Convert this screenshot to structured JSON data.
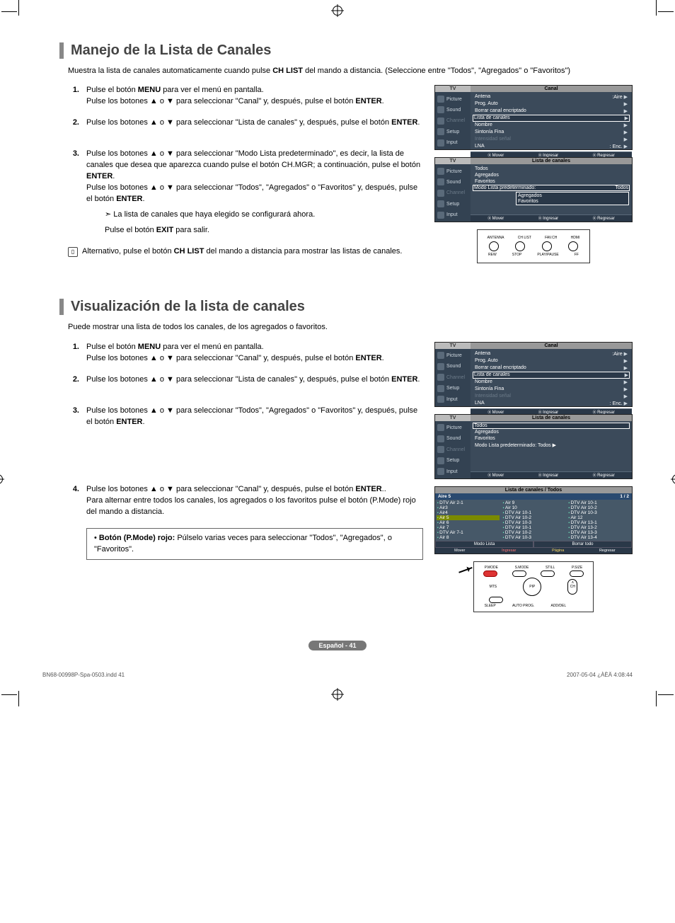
{
  "section1": {
    "title": "Manejo de la Lista de Canales",
    "intro_a": "Muestra la lista de canales automaticamente cuando pulse ",
    "intro_b_bold": "CH LIST",
    "intro_c": " del mando a distancia. (Seleccione entre \"Todos\", \"Agregados\" o \"Favoritos\")",
    "steps": {
      "s1n": "1.",
      "s1a": "Pulse el botón ",
      "s1b": "MENU",
      "s1c": " para ver el menú en pantalla.",
      "s1d": "Pulse los botones ▲ o ▼ para seleccionar \"Canal\" y, después, pulse el botón ",
      "s1e": "ENTER",
      "s1f": ".",
      "s2n": "2.",
      "s2a": "Pulse los botones ▲ o ▼ para seleccionar \"Lista de canales\" y, después, pulse el botón ",
      "s2b": "ENTER",
      "s2c": ".",
      "s3n": "3.",
      "s3a": "Pulse los botones ▲ o ▼ para seleccionar \"Modo Lista predeterminado\", es decir, la lista de canales que desea que aparezca cuando pulse el botón CH.MGR; a continuación, pulse el botón ",
      "s3b": "ENTER",
      "s3c": ".",
      "s3d": "Pulse los botones ▲ o ▼ para seleccionar \"Todos\", \"Agregados\" o \"Favoritos\" y, después, pulse el botón ",
      "s3e": "ENTER",
      "s3f": ".",
      "s3note": "La lista de canales que haya elegido se configurará ahora.",
      "s3exit_a": "Pulse el botón ",
      "s3exit_b": "EXIT",
      "s3exit_c": " para salir.",
      "alt_a": "Alternativo, pulse el botón ",
      "alt_b": "CH LIST",
      "alt_c": " del mando a distancia para mostrar las listas de canales."
    }
  },
  "section2": {
    "title": "Visualización de la lista de canales",
    "intro": "Puede mostrar una lista de todos los canales, de los agregados o favoritos.",
    "steps": {
      "s1n": "1.",
      "s1a": "Pulse el botón ",
      "s1b": "MENU",
      "s1c": " para ver el menú en pantalla.",
      "s1d": "Pulse los botones ▲ o ▼ para seleccionar \"Canal\" y, después, pulse el botón ",
      "s1e": "ENTER",
      "s1f": ".",
      "s2n": "2.",
      "s2a": "Pulse los botones ▲ o ▼ para seleccionar \"Lista de canales\" y, después, pulse el botón ",
      "s2b": "ENTER",
      "s2c": ".",
      "s3n": "3.",
      "s3a": "Pulse los botones ▲ o ▼ para seleccionar \"Todos\", \"Agregados\" o \"Favoritos\" y, después, pulse el botón ",
      "s3b": "ENTER",
      "s3c": ".",
      "s4n": "4.",
      "s4a": "Pulse los botones ▲ o ▼ para seleccionar \"Canal\" y, después, pulse el botón ",
      "s4b": "ENTER",
      "s4c": "..",
      "s4d": "Para alternar entre todos los canales, los agregados o los favoritos pulse el botón (P.Mode) rojo del mando a distancia.",
      "tip_a": "• ",
      "tip_b": "Botón (P.Mode) rojo:",
      "tip_c": " Púlselo varias veces para seleccionar \"Todos\", \"Agregados\", o \"Favoritos\"."
    }
  },
  "osd": {
    "tv": "TV",
    "nav": {
      "picture": "Picture",
      "sound": "Sound",
      "channel": "Channel",
      "setup": "Setup",
      "input": "Input"
    },
    "canal_title": "Canal",
    "canal_items": {
      "antena": "Antena",
      "antena_v": ":Aire",
      "prog": "Prog. Auto",
      "borrar": "Borrar canal encriptado",
      "lista": "Lista de canales",
      "nombre": "Nombre",
      "sint": "Sintonía Fina",
      "int": "Intensidad señal",
      "lna": "LNA",
      "lna_v": ": Enc."
    },
    "foot": {
      "mover": "Mover",
      "ingresar": "Ingresar",
      "regresar": "Regresar"
    },
    "lista_title": "Lista de canales",
    "lista_items": {
      "todos": "Todos",
      "agr": "Agregados",
      "fav": "Favoritos",
      "modo": "Modo Lista predeterminado:",
      "modo_v": "Todos"
    },
    "sub": {
      "agr": "Agregados",
      "fav": "Favoritos"
    },
    "lista2_modo": "Modo Lista predeterminado: Todos ▶"
  },
  "remote1": {
    "antenna": "ANTENNA",
    "chlist": "CH LIST",
    "favch": "FAV.CH",
    "hdmi": "HDMI",
    "rew": "REW",
    "stop": "STOP",
    "play": "PLAY/PAUSE",
    "ff": "FF"
  },
  "chlist": {
    "title": "Lista de canales / Todos",
    "head": "Aire 5",
    "page": "1 / 2",
    "col1": [
      "DTV Air 2-1",
      "Air3",
      "Air4",
      "Air 5",
      "Air 6",
      "Air 7",
      "DTV Air 7-1",
      "Air 8"
    ],
    "col2": [
      "Air 9",
      "Air 10",
      "DTV Air 10-1",
      "DTV Air 10-2",
      "DTV Air 10-3",
      "DTV Air 10-1",
      "DTV Air 10-2",
      "DTV Air 10-3"
    ],
    "col3": [
      "DTV Air 10-1",
      "DTV Air 10-2",
      "DTV Air 10-3",
      "Air 12",
      "DTV Air 13-1",
      "DTV Air 13-2",
      "DTV Air 13-3",
      "DTV Air 13-4"
    ],
    "btns": {
      "modo": "Modo Lista",
      "borrar": "Borrar todo"
    },
    "foot": {
      "mover": "Mover",
      "ingresar": "Ingresar",
      "pagina": "Página",
      "regresar": "Regresar"
    }
  },
  "remote2": {
    "pmode": "P.MODE",
    "smode": "S.MODE",
    "still": "STILL",
    "psize": "P.SIZE",
    "mts": "MTS",
    "pip": "PIP",
    "sleep": "SLEEP",
    "autoprog": "AUTO PROG.",
    "adddel": "ADD/DEL",
    "ch": "CH",
    "up": "∧"
  },
  "footer": {
    "page": "Español - 41",
    "file": "BN68-00998P-Spa-0503.indd   41",
    "date": "2007-05-04   ¿ÀÈÄ 4:08:44"
  }
}
